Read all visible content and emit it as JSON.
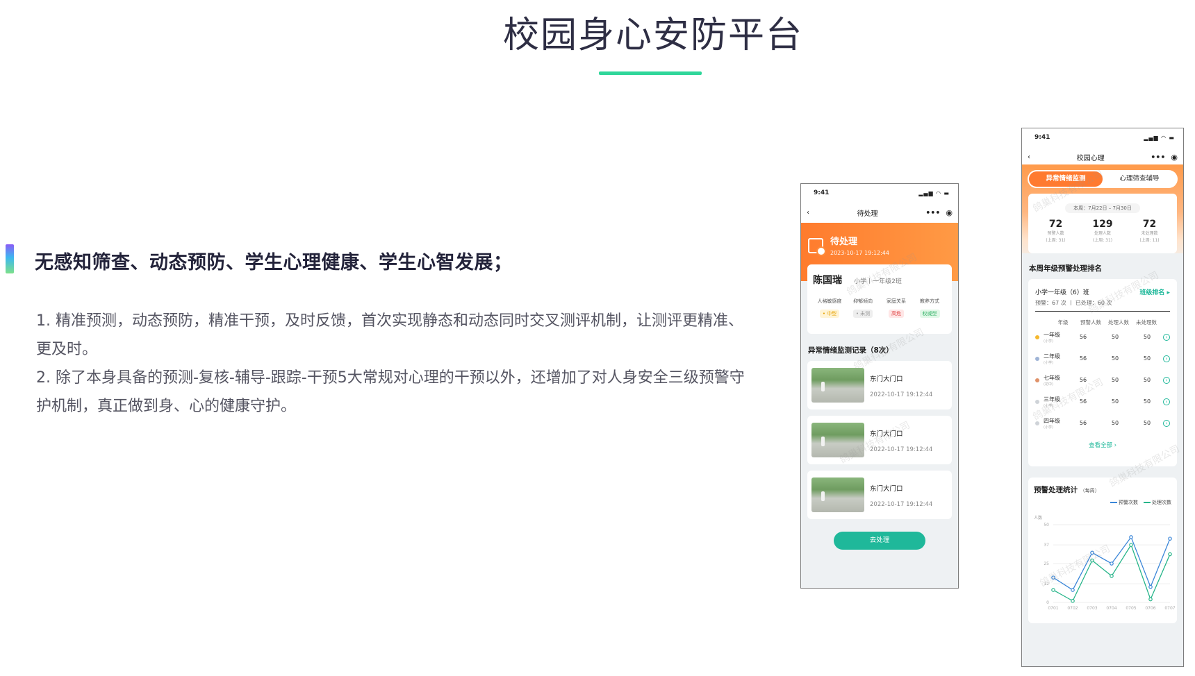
{
  "page": {
    "title": "校园身心安防平台",
    "headline": "无感知筛查、动态预防、学生心理健康、学生心智发展；",
    "paragraphs": [
      "1. 精准预测，动态预防，精准干预，及时反馈，首次实现静态和动态同时交叉测评机制，让测评更精准、更及时。",
      "2. 除了本身具备的预测-复核-辅导-跟踪-干预5大常规对心理的干预以外，还增加了对人身安全三级预警守护机制，真正做到身、心的健康守护。"
    ],
    "accent_color": "#2fd69a"
  },
  "phone1": {
    "time": "9:41",
    "nav_title": "待处理",
    "status": "待处理",
    "status_time": "2023-10-17 19:12:44",
    "student_name": "陈国瑞",
    "student_class": "小学丨一年级2班",
    "metrics": [
      {
        "label": "人格敏感度",
        "tag": "• 中型"
      },
      {
        "label": "抑郁倾向",
        "tag": "• 未测"
      },
      {
        "label": "家庭关系",
        "tag": "高危"
      },
      {
        "label": "教养方式",
        "tag": "权威型"
      }
    ],
    "records_title": "异常情绪监测记录（8次）",
    "records": [
      {
        "place": "东门大门口",
        "time": "2022-10-17  19:12:44"
      },
      {
        "place": "东门大门口",
        "time": "2022-10-17  19:12:44"
      },
      {
        "place": "东门大门口",
        "time": "2022-10-17  19:12:44"
      }
    ],
    "button": "去处理",
    "watermark": "鸽巢科技有限公司"
  },
  "phone2": {
    "time": "9:41",
    "nav_title": "校园心理",
    "tabs": [
      "异常情绪监测",
      "心理筛查辅导"
    ],
    "week_range": "本周：7月22日 – 7月30日",
    "stats": [
      {
        "value": "72",
        "label": "预警人数",
        "sub": "(上周: 31)"
      },
      {
        "value": "129",
        "label": "处理人数",
        "sub": "(上周: 31)"
      },
      {
        "value": "72",
        "label": "未处理数",
        "sub": "(上周: 11)"
      }
    ],
    "rank_title": "本周年级预警处理排名",
    "rank_class": "小学一年级（6）班",
    "rank_link": "班级排名 ▸",
    "rank_sub": "预警：67 次 丨 已处理：60 次",
    "rank_columns": [
      "年级",
      "预警人数",
      "处理人数",
      "未处理数"
    ],
    "rank_rows": [
      {
        "grade": "一年级",
        "level": "(小学)",
        "warn": "56",
        "done": "50",
        "pending": "50",
        "color": "#f5b82e"
      },
      {
        "grade": "二年级",
        "level": "(小学)",
        "warn": "56",
        "done": "50",
        "pending": "50",
        "color": "#9fb4d6"
      },
      {
        "grade": "七年级",
        "level": "(初中)",
        "warn": "56",
        "done": "50",
        "pending": "50",
        "color": "#e0926a"
      },
      {
        "grade": "三年级",
        "level": "(小学)",
        "warn": "56",
        "done": "50",
        "pending": "50",
        "color": "#cfd3d8"
      },
      {
        "grade": "四年级",
        "level": "(小学)",
        "warn": "56",
        "done": "50",
        "pending": "50",
        "color": "#cfd3d8"
      }
    ],
    "see_all": "查看全部 ›",
    "chart_title": "预警处理统计",
    "chart_title_unit": "（每周）",
    "watermark": "鸽巢科技有限公司"
  },
  "chart_data": {
    "type": "line",
    "title": "预警处理统计",
    "ylabel": "人数",
    "x": [
      "0701",
      "0702",
      "0703",
      "0704",
      "0705",
      "0706",
      "0707"
    ],
    "yticks": [
      0,
      12,
      25,
      37,
      50
    ],
    "ylim": [
      0,
      50
    ],
    "series": [
      {
        "name": "预警次数",
        "color": "#3a86d8",
        "values": [
          16,
          8,
          32,
          25,
          42,
          10,
          41
        ]
      },
      {
        "name": "处理次数",
        "color": "#27b58a",
        "values": [
          8,
          1,
          27,
          17,
          37,
          2,
          31
        ]
      }
    ],
    "legend": "top-right"
  }
}
